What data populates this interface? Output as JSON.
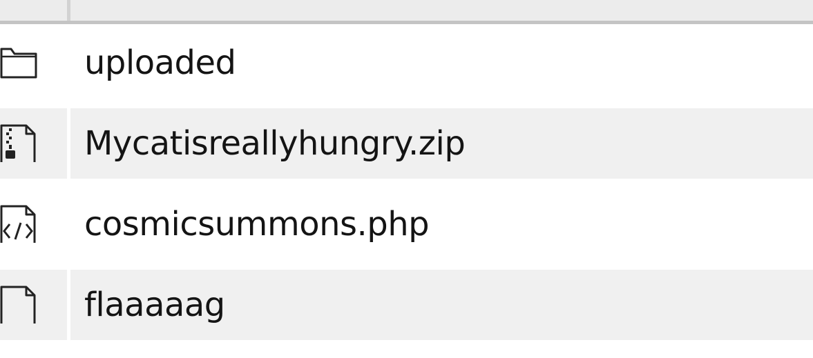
{
  "files": [
    {
      "name": "uploaded",
      "icon": "folder-icon"
    },
    {
      "name": "Mycatisreallyhungry.zip",
      "icon": "zip-file-icon"
    },
    {
      "name": "cosmicsummons.php",
      "icon": "code-file-icon"
    },
    {
      "name": "flaaaaag",
      "icon": "file-icon"
    }
  ]
}
